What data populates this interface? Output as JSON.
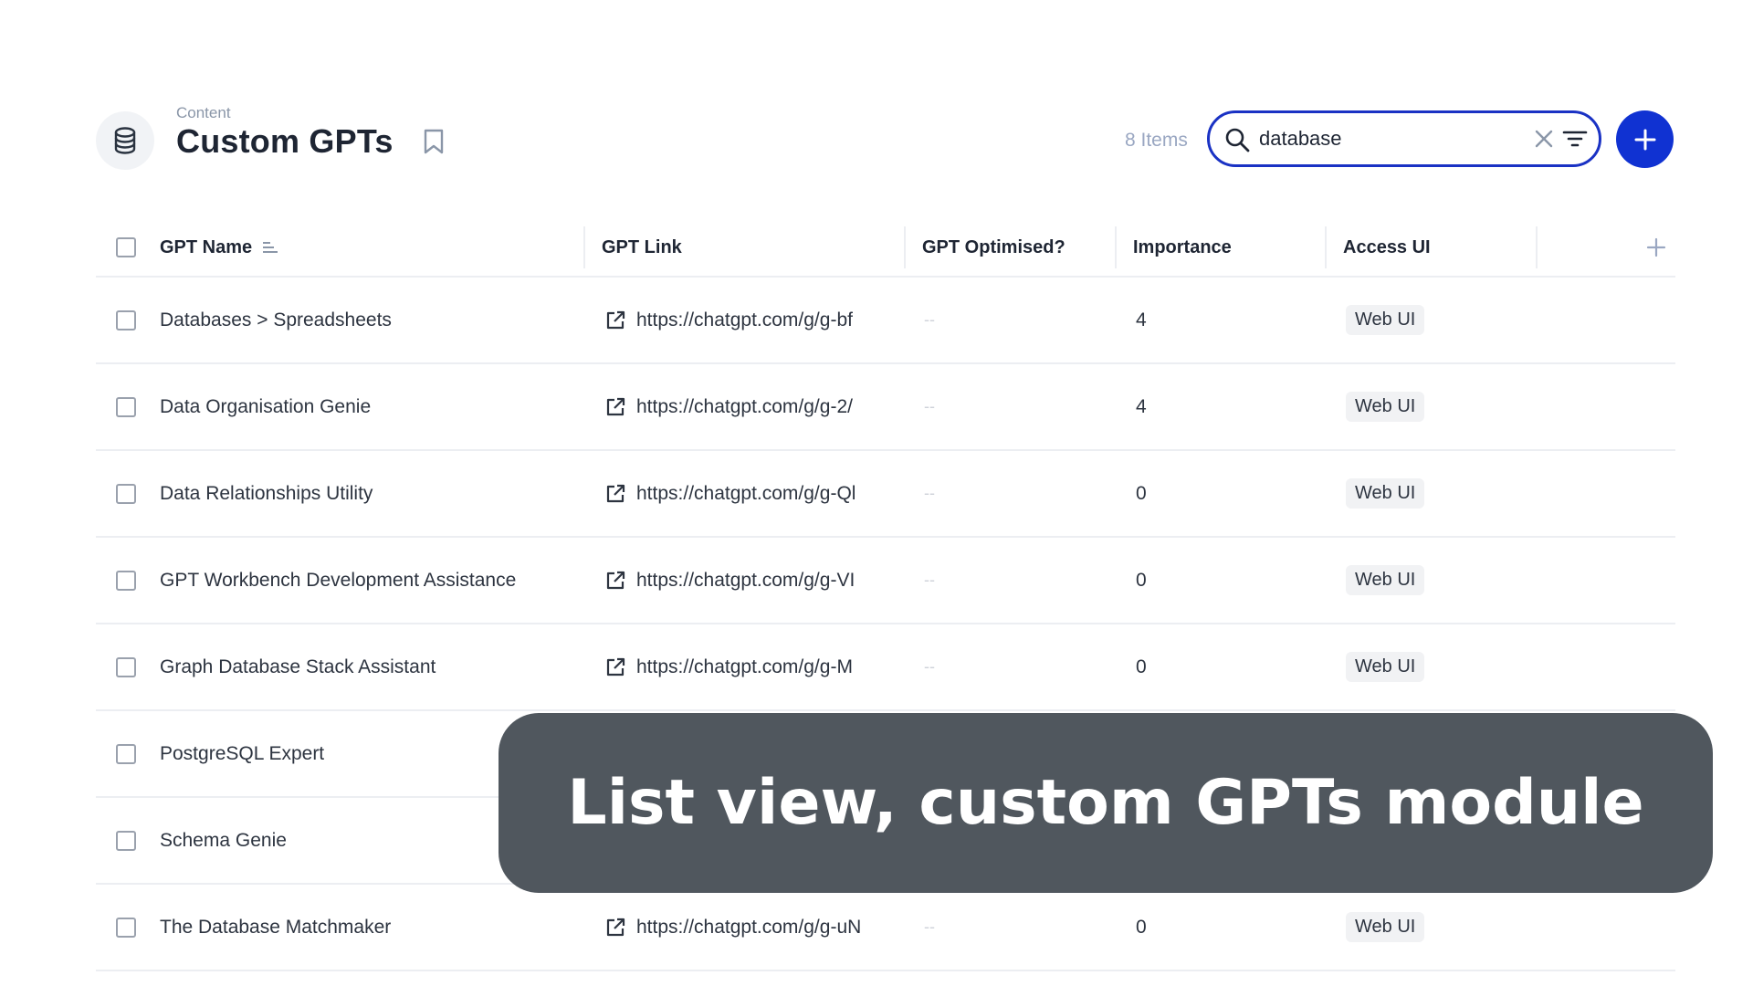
{
  "header": {
    "breadcrumb": "Content",
    "title": "Custom GPTs",
    "module_icon": "database-icon",
    "bookmark_icon": "bookmark-icon",
    "item_count": "8 Items",
    "add_icon": "plus-icon"
  },
  "search": {
    "value": "database",
    "icon": "search-icon",
    "clear_icon": "close-icon",
    "filter_icon": "filter-icon"
  },
  "table": {
    "columns": [
      {
        "label": "GPT Name",
        "sorted": true
      },
      {
        "label": "GPT Link"
      },
      {
        "label": "GPT Optimised?"
      },
      {
        "label": "Importance"
      },
      {
        "label": "Access UI"
      }
    ],
    "rows": [
      {
        "name": "Databases > Spreadsheets",
        "link": "https://chatgpt.com/g/g-bf",
        "optimised": "--",
        "importance": "4",
        "access": "Web UI"
      },
      {
        "name": "Data Organisation Genie",
        "link": "https://chatgpt.com/g/g-2/",
        "optimised": "--",
        "importance": "4",
        "access": "Web UI"
      },
      {
        "name": "Data Relationships Utility",
        "link": "https://chatgpt.com/g/g-Ql",
        "optimised": "--",
        "importance": "0",
        "access": "Web UI"
      },
      {
        "name": "GPT Workbench Development Assistance",
        "link": "https://chatgpt.com/g/g-VI",
        "optimised": "--",
        "importance": "0",
        "access": "Web UI"
      },
      {
        "name": "Graph Database Stack Assistant",
        "link": "https://chatgpt.com/g/g-M",
        "optimised": "--",
        "importance": "0",
        "access": "Web UI"
      },
      {
        "name": "PostgreSQL Expert"
      },
      {
        "name": "Schema Genie"
      },
      {
        "name": "The Database Matchmaker",
        "link": "https://chatgpt.com/g/g-uN",
        "optimised": "--",
        "importance": "0",
        "access": "Web UI"
      }
    ]
  },
  "caption": {
    "text": "List view, custom GPTs module"
  },
  "colors": {
    "accent": "#1032d2",
    "search_border": "#1a32c4",
    "caption_bg": "#50575e",
    "muted_text": "#9aa7c2"
  }
}
